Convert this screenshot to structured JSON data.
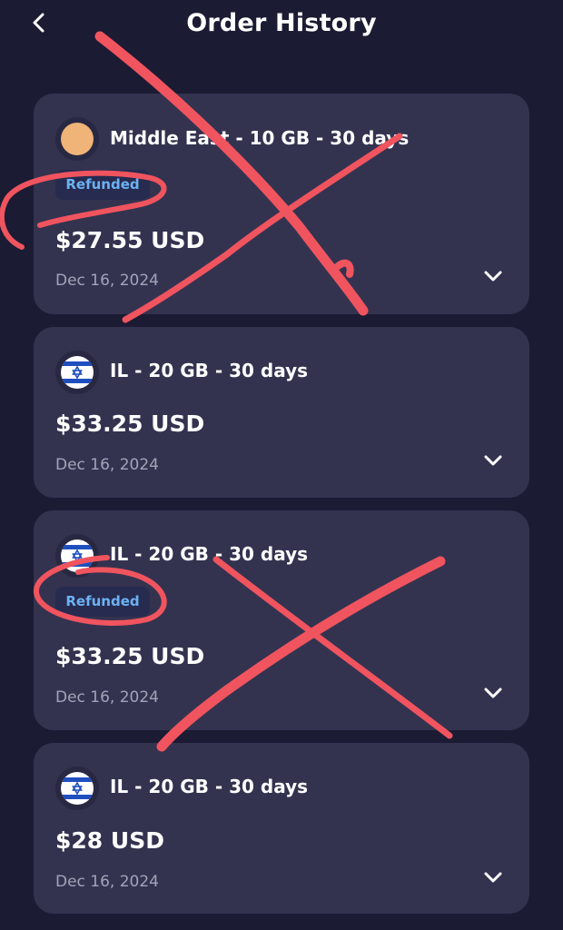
{
  "header": {
    "title": "Order History",
    "back_icon": "chevron-left-icon"
  },
  "orders": [
    {
      "flag": "circle-flag-icon",
      "plan": "Middle East - 10 GB - 30 days",
      "status": "Refunded",
      "price": "$27.55 USD",
      "date": "Dec 16, 2024"
    },
    {
      "flag": "israel-flag-icon",
      "plan": "IL - 20 GB - 30 days",
      "price": "$33.25 USD",
      "date": "Dec 16, 2024"
    },
    {
      "flag": "israel-flag-icon",
      "plan": "IL - 20 GB - 30 days",
      "status": "Refunded",
      "price": "$33.25 USD",
      "date": "Dec 16, 2024"
    },
    {
      "flag": "israel-flag-icon",
      "plan": "IL - 20 GB - 30 days",
      "price": "$28 USD",
      "date": "Dec 16, 2024"
    }
  ],
  "colors": {
    "background": "#1b1b33",
    "card": "#333350",
    "badge_bg": "#272b4f",
    "badge_text": "#6cb2f4",
    "annotation": "#f0545e"
  }
}
